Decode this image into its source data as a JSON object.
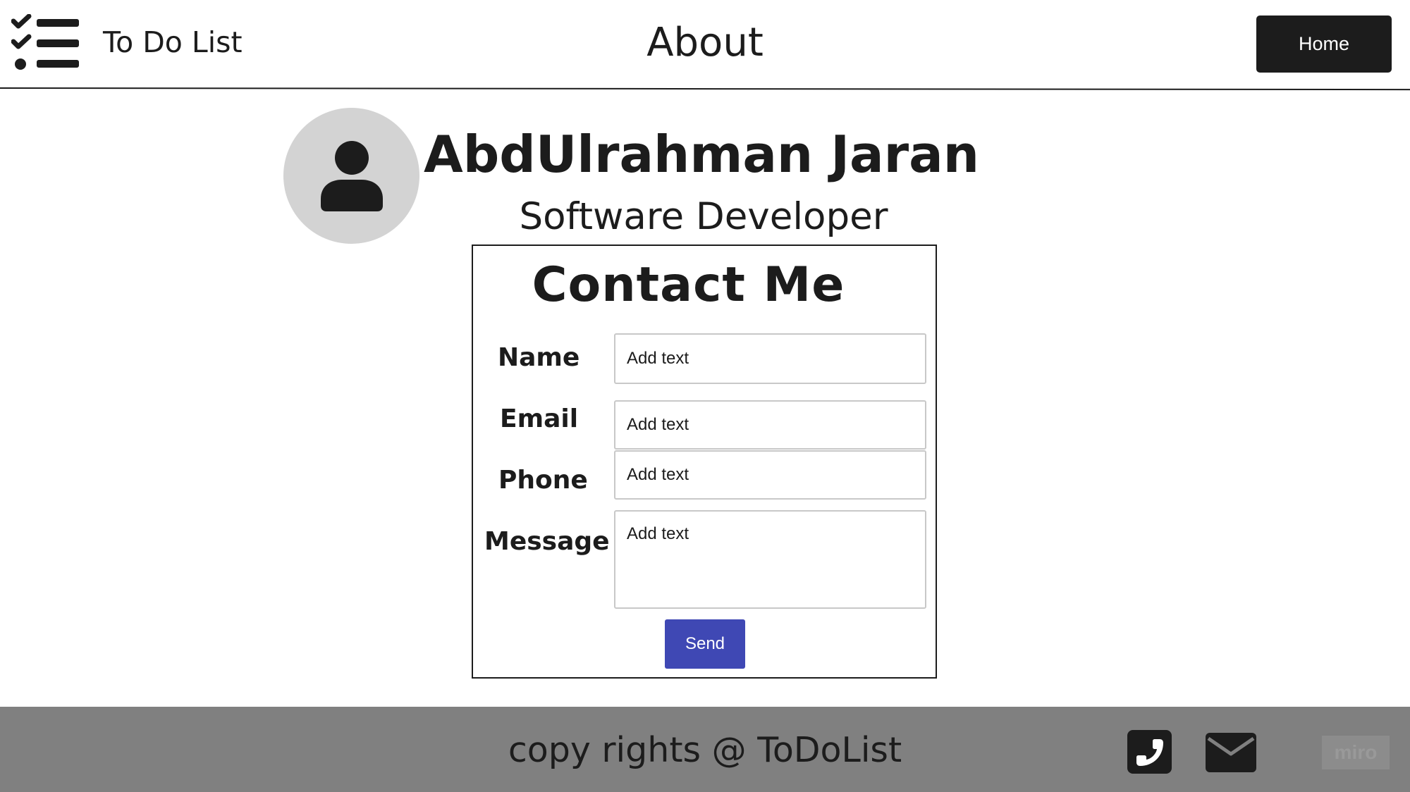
{
  "header": {
    "app_title": "To Do List",
    "page_title": "About",
    "home_label": "Home"
  },
  "profile": {
    "name": "AbdUlrahman Jaran",
    "role": "Software Developer"
  },
  "contact": {
    "title": "Contact Me",
    "fields": [
      {
        "label": "Name",
        "placeholder": "Add text"
      },
      {
        "label": "Email",
        "placeholder": "Add text"
      },
      {
        "label": "Phone",
        "placeholder": "Add text"
      },
      {
        "label": "Message",
        "placeholder": "Add text"
      }
    ],
    "send_label": "Send"
  },
  "footer": {
    "copyright": "copy rights @ ToDoList",
    "badge": "miro"
  },
  "icons": {
    "logo": "checklist-icon",
    "avatar": "user-icon",
    "phone": "phone-icon",
    "email": "envelope-icon"
  },
  "colors": {
    "dark": "#1c1c1c",
    "accent": "#3f48b4",
    "footer_bg": "#808080",
    "avatar_bg": "#d3d3d3"
  }
}
